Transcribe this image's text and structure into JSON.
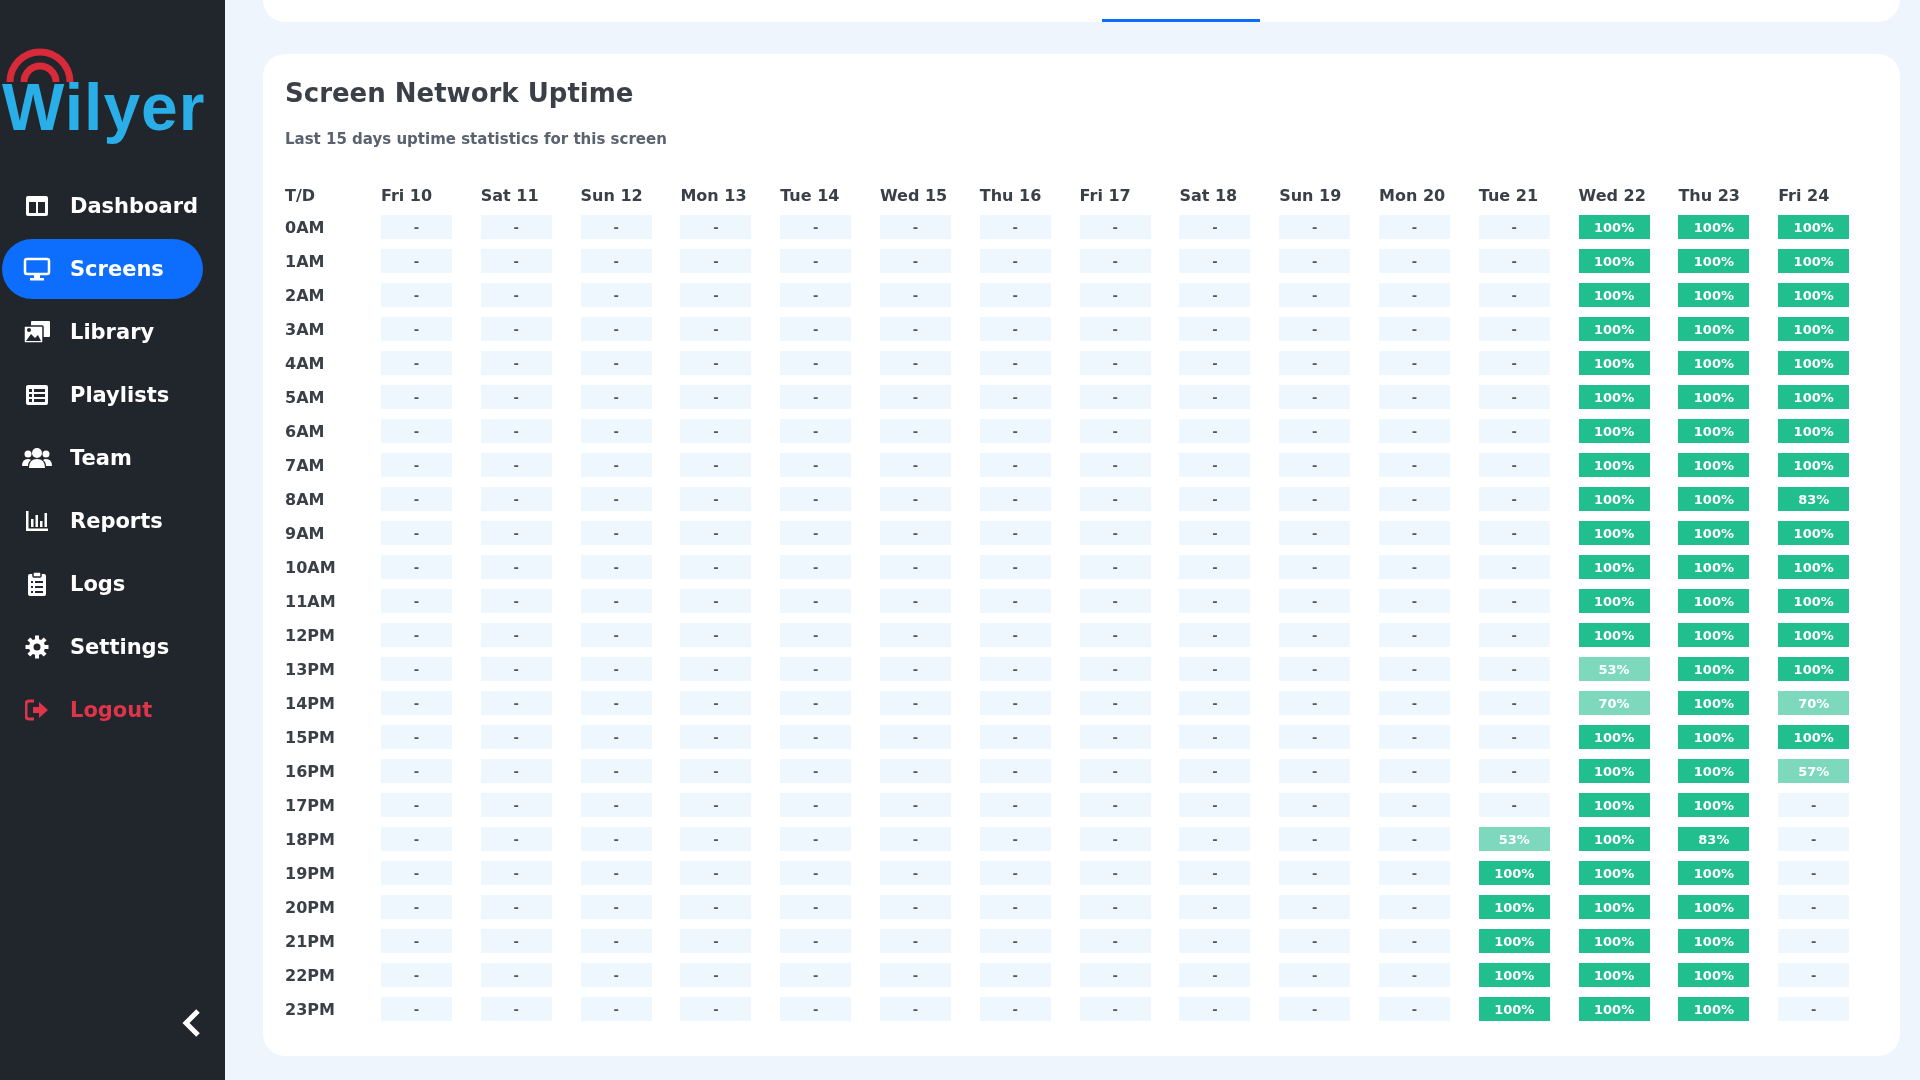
{
  "sidebar": {
    "logo": "Wilyer",
    "items": [
      {
        "label": "Dashboard",
        "selected": false,
        "kind": "normal"
      },
      {
        "label": "Screens",
        "selected": true,
        "kind": "normal"
      },
      {
        "label": "Library",
        "selected": false,
        "kind": "normal"
      },
      {
        "label": "Playlists",
        "selected": false,
        "kind": "normal"
      },
      {
        "label": "Team",
        "selected": false,
        "kind": "normal"
      },
      {
        "label": "Reports",
        "selected": false,
        "kind": "normal"
      },
      {
        "label": "Logs",
        "selected": false,
        "kind": "normal"
      },
      {
        "label": "Settings",
        "selected": false,
        "kind": "normal"
      },
      {
        "label": "Logout",
        "selected": false,
        "kind": "danger"
      }
    ]
  },
  "uptime": {
    "title": "Screen Network Uptime",
    "subtitle": "Last 15 days uptime statistics for this screen",
    "corner": "T/D",
    "columns": [
      "Fri 10",
      "Sat 11",
      "Sun 12",
      "Mon 13",
      "Tue 14",
      "Wed 15",
      "Thu 16",
      "Fri 17",
      "Sat 18",
      "Sun 19",
      "Mon 20",
      "Tue 21",
      "Wed 22",
      "Thu 23",
      "Fri 24"
    ],
    "rows": [
      {
        "time": "0AM",
        "cells": [
          {
            "text": "-",
            "kind": "empty"
          },
          {
            "text": "-",
            "kind": "empty"
          },
          {
            "text": "-",
            "kind": "empty"
          },
          {
            "text": "-",
            "kind": "empty"
          },
          {
            "text": "-",
            "kind": "empty"
          },
          {
            "text": "-",
            "kind": "empty"
          },
          {
            "text": "-",
            "kind": "empty"
          },
          {
            "text": "-",
            "kind": "empty"
          },
          {
            "text": "-",
            "kind": "empty"
          },
          {
            "text": "-",
            "kind": "empty"
          },
          {
            "text": "-",
            "kind": "empty"
          },
          {
            "text": "-",
            "kind": "empty"
          },
          {
            "text": "100%",
            "kind": "full"
          },
          {
            "text": "100%",
            "kind": "full"
          },
          {
            "text": "100%",
            "kind": "full"
          }
        ]
      },
      {
        "time": "1AM",
        "cells": [
          {
            "text": "-",
            "kind": "empty"
          },
          {
            "text": "-",
            "kind": "empty"
          },
          {
            "text": "-",
            "kind": "empty"
          },
          {
            "text": "-",
            "kind": "empty"
          },
          {
            "text": "-",
            "kind": "empty"
          },
          {
            "text": "-",
            "kind": "empty"
          },
          {
            "text": "-",
            "kind": "empty"
          },
          {
            "text": "-",
            "kind": "empty"
          },
          {
            "text": "-",
            "kind": "empty"
          },
          {
            "text": "-",
            "kind": "empty"
          },
          {
            "text": "-",
            "kind": "empty"
          },
          {
            "text": "-",
            "kind": "empty"
          },
          {
            "text": "100%",
            "kind": "full"
          },
          {
            "text": "100%",
            "kind": "full"
          },
          {
            "text": "100%",
            "kind": "full"
          }
        ]
      },
      {
        "time": "2AM",
        "cells": [
          {
            "text": "-",
            "kind": "empty"
          },
          {
            "text": "-",
            "kind": "empty"
          },
          {
            "text": "-",
            "kind": "empty"
          },
          {
            "text": "-",
            "kind": "empty"
          },
          {
            "text": "-",
            "kind": "empty"
          },
          {
            "text": "-",
            "kind": "empty"
          },
          {
            "text": "-",
            "kind": "empty"
          },
          {
            "text": "-",
            "kind": "empty"
          },
          {
            "text": "-",
            "kind": "empty"
          },
          {
            "text": "-",
            "kind": "empty"
          },
          {
            "text": "-",
            "kind": "empty"
          },
          {
            "text": "-",
            "kind": "empty"
          },
          {
            "text": "100%",
            "kind": "full"
          },
          {
            "text": "100%",
            "kind": "full"
          },
          {
            "text": "100%",
            "kind": "full"
          }
        ]
      },
      {
        "time": "3AM",
        "cells": [
          {
            "text": "-",
            "kind": "empty"
          },
          {
            "text": "-",
            "kind": "empty"
          },
          {
            "text": "-",
            "kind": "empty"
          },
          {
            "text": "-",
            "kind": "empty"
          },
          {
            "text": "-",
            "kind": "empty"
          },
          {
            "text": "-",
            "kind": "empty"
          },
          {
            "text": "-",
            "kind": "empty"
          },
          {
            "text": "-",
            "kind": "empty"
          },
          {
            "text": "-",
            "kind": "empty"
          },
          {
            "text": "-",
            "kind": "empty"
          },
          {
            "text": "-",
            "kind": "empty"
          },
          {
            "text": "-",
            "kind": "empty"
          },
          {
            "text": "100%",
            "kind": "full"
          },
          {
            "text": "100%",
            "kind": "full"
          },
          {
            "text": "100%",
            "kind": "full"
          }
        ]
      },
      {
        "time": "4AM",
        "cells": [
          {
            "text": "-",
            "kind": "empty"
          },
          {
            "text": "-",
            "kind": "empty"
          },
          {
            "text": "-",
            "kind": "empty"
          },
          {
            "text": "-",
            "kind": "empty"
          },
          {
            "text": "-",
            "kind": "empty"
          },
          {
            "text": "-",
            "kind": "empty"
          },
          {
            "text": "-",
            "kind": "empty"
          },
          {
            "text": "-",
            "kind": "empty"
          },
          {
            "text": "-",
            "kind": "empty"
          },
          {
            "text": "-",
            "kind": "empty"
          },
          {
            "text": "-",
            "kind": "empty"
          },
          {
            "text": "-",
            "kind": "empty"
          },
          {
            "text": "100%",
            "kind": "full"
          },
          {
            "text": "100%",
            "kind": "full"
          },
          {
            "text": "100%",
            "kind": "full"
          }
        ]
      },
      {
        "time": "5AM",
        "cells": [
          {
            "text": "-",
            "kind": "empty"
          },
          {
            "text": "-",
            "kind": "empty"
          },
          {
            "text": "-",
            "kind": "empty"
          },
          {
            "text": "-",
            "kind": "empty"
          },
          {
            "text": "-",
            "kind": "empty"
          },
          {
            "text": "-",
            "kind": "empty"
          },
          {
            "text": "-",
            "kind": "empty"
          },
          {
            "text": "-",
            "kind": "empty"
          },
          {
            "text": "-",
            "kind": "empty"
          },
          {
            "text": "-",
            "kind": "empty"
          },
          {
            "text": "-",
            "kind": "empty"
          },
          {
            "text": "-",
            "kind": "empty"
          },
          {
            "text": "100%",
            "kind": "full"
          },
          {
            "text": "100%",
            "kind": "full"
          },
          {
            "text": "100%",
            "kind": "full"
          }
        ]
      },
      {
        "time": "6AM",
        "cells": [
          {
            "text": "-",
            "kind": "empty"
          },
          {
            "text": "-",
            "kind": "empty"
          },
          {
            "text": "-",
            "kind": "empty"
          },
          {
            "text": "-",
            "kind": "empty"
          },
          {
            "text": "-",
            "kind": "empty"
          },
          {
            "text": "-",
            "kind": "empty"
          },
          {
            "text": "-",
            "kind": "empty"
          },
          {
            "text": "-",
            "kind": "empty"
          },
          {
            "text": "-",
            "kind": "empty"
          },
          {
            "text": "-",
            "kind": "empty"
          },
          {
            "text": "-",
            "kind": "empty"
          },
          {
            "text": "-",
            "kind": "empty"
          },
          {
            "text": "100%",
            "kind": "full"
          },
          {
            "text": "100%",
            "kind": "full"
          },
          {
            "text": "100%",
            "kind": "full"
          }
        ]
      },
      {
        "time": "7AM",
        "cells": [
          {
            "text": "-",
            "kind": "empty"
          },
          {
            "text": "-",
            "kind": "empty"
          },
          {
            "text": "-",
            "kind": "empty"
          },
          {
            "text": "-",
            "kind": "empty"
          },
          {
            "text": "-",
            "kind": "empty"
          },
          {
            "text": "-",
            "kind": "empty"
          },
          {
            "text": "-",
            "kind": "empty"
          },
          {
            "text": "-",
            "kind": "empty"
          },
          {
            "text": "-",
            "kind": "empty"
          },
          {
            "text": "-",
            "kind": "empty"
          },
          {
            "text": "-",
            "kind": "empty"
          },
          {
            "text": "-",
            "kind": "empty"
          },
          {
            "text": "100%",
            "kind": "full"
          },
          {
            "text": "100%",
            "kind": "full"
          },
          {
            "text": "100%",
            "kind": "full"
          }
        ]
      },
      {
        "time": "8AM",
        "cells": [
          {
            "text": "-",
            "kind": "empty"
          },
          {
            "text": "-",
            "kind": "empty"
          },
          {
            "text": "-",
            "kind": "empty"
          },
          {
            "text": "-",
            "kind": "empty"
          },
          {
            "text": "-",
            "kind": "empty"
          },
          {
            "text": "-",
            "kind": "empty"
          },
          {
            "text": "-",
            "kind": "empty"
          },
          {
            "text": "-",
            "kind": "empty"
          },
          {
            "text": "-",
            "kind": "empty"
          },
          {
            "text": "-",
            "kind": "empty"
          },
          {
            "text": "-",
            "kind": "empty"
          },
          {
            "text": "-",
            "kind": "empty"
          },
          {
            "text": "100%",
            "kind": "full"
          },
          {
            "text": "100%",
            "kind": "full"
          },
          {
            "text": "83%",
            "kind": "full"
          }
        ]
      },
      {
        "time": "9AM",
        "cells": [
          {
            "text": "-",
            "kind": "empty"
          },
          {
            "text": "-",
            "kind": "empty"
          },
          {
            "text": "-",
            "kind": "empty"
          },
          {
            "text": "-",
            "kind": "empty"
          },
          {
            "text": "-",
            "kind": "empty"
          },
          {
            "text": "-",
            "kind": "empty"
          },
          {
            "text": "-",
            "kind": "empty"
          },
          {
            "text": "-",
            "kind": "empty"
          },
          {
            "text": "-",
            "kind": "empty"
          },
          {
            "text": "-",
            "kind": "empty"
          },
          {
            "text": "-",
            "kind": "empty"
          },
          {
            "text": "-",
            "kind": "empty"
          },
          {
            "text": "100%",
            "kind": "full"
          },
          {
            "text": "100%",
            "kind": "full"
          },
          {
            "text": "100%",
            "kind": "full"
          }
        ]
      },
      {
        "time": "10AM",
        "cells": [
          {
            "text": "-",
            "kind": "empty"
          },
          {
            "text": "-",
            "kind": "empty"
          },
          {
            "text": "-",
            "kind": "empty"
          },
          {
            "text": "-",
            "kind": "empty"
          },
          {
            "text": "-",
            "kind": "empty"
          },
          {
            "text": "-",
            "kind": "empty"
          },
          {
            "text": "-",
            "kind": "empty"
          },
          {
            "text": "-",
            "kind": "empty"
          },
          {
            "text": "-",
            "kind": "empty"
          },
          {
            "text": "-",
            "kind": "empty"
          },
          {
            "text": "-",
            "kind": "empty"
          },
          {
            "text": "-",
            "kind": "empty"
          },
          {
            "text": "100%",
            "kind": "full"
          },
          {
            "text": "100%",
            "kind": "full"
          },
          {
            "text": "100%",
            "kind": "full"
          }
        ]
      },
      {
        "time": "11AM",
        "cells": [
          {
            "text": "-",
            "kind": "empty"
          },
          {
            "text": "-",
            "kind": "empty"
          },
          {
            "text": "-",
            "kind": "empty"
          },
          {
            "text": "-",
            "kind": "empty"
          },
          {
            "text": "-",
            "kind": "empty"
          },
          {
            "text": "-",
            "kind": "empty"
          },
          {
            "text": "-",
            "kind": "empty"
          },
          {
            "text": "-",
            "kind": "empty"
          },
          {
            "text": "-",
            "kind": "empty"
          },
          {
            "text": "-",
            "kind": "empty"
          },
          {
            "text": "-",
            "kind": "empty"
          },
          {
            "text": "-",
            "kind": "empty"
          },
          {
            "text": "100%",
            "kind": "full"
          },
          {
            "text": "100%",
            "kind": "full"
          },
          {
            "text": "100%",
            "kind": "full"
          }
        ]
      },
      {
        "time": "12PM",
        "cells": [
          {
            "text": "-",
            "kind": "empty"
          },
          {
            "text": "-",
            "kind": "empty"
          },
          {
            "text": "-",
            "kind": "empty"
          },
          {
            "text": "-",
            "kind": "empty"
          },
          {
            "text": "-",
            "kind": "empty"
          },
          {
            "text": "-",
            "kind": "empty"
          },
          {
            "text": "-",
            "kind": "empty"
          },
          {
            "text": "-",
            "kind": "empty"
          },
          {
            "text": "-",
            "kind": "empty"
          },
          {
            "text": "-",
            "kind": "empty"
          },
          {
            "text": "-",
            "kind": "empty"
          },
          {
            "text": "-",
            "kind": "empty"
          },
          {
            "text": "100%",
            "kind": "full"
          },
          {
            "text": "100%",
            "kind": "full"
          },
          {
            "text": "100%",
            "kind": "full"
          }
        ]
      },
      {
        "time": "13PM",
        "cells": [
          {
            "text": "-",
            "kind": "empty"
          },
          {
            "text": "-",
            "kind": "empty"
          },
          {
            "text": "-",
            "kind": "empty"
          },
          {
            "text": "-",
            "kind": "empty"
          },
          {
            "text": "-",
            "kind": "empty"
          },
          {
            "text": "-",
            "kind": "empty"
          },
          {
            "text": "-",
            "kind": "empty"
          },
          {
            "text": "-",
            "kind": "empty"
          },
          {
            "text": "-",
            "kind": "empty"
          },
          {
            "text": "-",
            "kind": "empty"
          },
          {
            "text": "-",
            "kind": "empty"
          },
          {
            "text": "-",
            "kind": "empty"
          },
          {
            "text": "53%",
            "kind": "partial"
          },
          {
            "text": "100%",
            "kind": "full"
          },
          {
            "text": "100%",
            "kind": "full"
          }
        ]
      },
      {
        "time": "14PM",
        "cells": [
          {
            "text": "-",
            "kind": "empty"
          },
          {
            "text": "-",
            "kind": "empty"
          },
          {
            "text": "-",
            "kind": "empty"
          },
          {
            "text": "-",
            "kind": "empty"
          },
          {
            "text": "-",
            "kind": "empty"
          },
          {
            "text": "-",
            "kind": "empty"
          },
          {
            "text": "-",
            "kind": "empty"
          },
          {
            "text": "-",
            "kind": "empty"
          },
          {
            "text": "-",
            "kind": "empty"
          },
          {
            "text": "-",
            "kind": "empty"
          },
          {
            "text": "-",
            "kind": "empty"
          },
          {
            "text": "-",
            "kind": "empty"
          },
          {
            "text": "70%",
            "kind": "partial"
          },
          {
            "text": "100%",
            "kind": "full"
          },
          {
            "text": "70%",
            "kind": "partial"
          }
        ]
      },
      {
        "time": "15PM",
        "cells": [
          {
            "text": "-",
            "kind": "empty"
          },
          {
            "text": "-",
            "kind": "empty"
          },
          {
            "text": "-",
            "kind": "empty"
          },
          {
            "text": "-",
            "kind": "empty"
          },
          {
            "text": "-",
            "kind": "empty"
          },
          {
            "text": "-",
            "kind": "empty"
          },
          {
            "text": "-",
            "kind": "empty"
          },
          {
            "text": "-",
            "kind": "empty"
          },
          {
            "text": "-",
            "kind": "empty"
          },
          {
            "text": "-",
            "kind": "empty"
          },
          {
            "text": "-",
            "kind": "empty"
          },
          {
            "text": "-",
            "kind": "empty"
          },
          {
            "text": "100%",
            "kind": "full"
          },
          {
            "text": "100%",
            "kind": "full"
          },
          {
            "text": "100%",
            "kind": "full"
          }
        ]
      },
      {
        "time": "16PM",
        "cells": [
          {
            "text": "-",
            "kind": "empty"
          },
          {
            "text": "-",
            "kind": "empty"
          },
          {
            "text": "-",
            "kind": "empty"
          },
          {
            "text": "-",
            "kind": "empty"
          },
          {
            "text": "-",
            "kind": "empty"
          },
          {
            "text": "-",
            "kind": "empty"
          },
          {
            "text": "-",
            "kind": "empty"
          },
          {
            "text": "-",
            "kind": "empty"
          },
          {
            "text": "-",
            "kind": "empty"
          },
          {
            "text": "-",
            "kind": "empty"
          },
          {
            "text": "-",
            "kind": "empty"
          },
          {
            "text": "-",
            "kind": "empty"
          },
          {
            "text": "100%",
            "kind": "full"
          },
          {
            "text": "100%",
            "kind": "full"
          },
          {
            "text": "57%",
            "kind": "partial"
          }
        ]
      },
      {
        "time": "17PM",
        "cells": [
          {
            "text": "-",
            "kind": "empty"
          },
          {
            "text": "-",
            "kind": "empty"
          },
          {
            "text": "-",
            "kind": "empty"
          },
          {
            "text": "-",
            "kind": "empty"
          },
          {
            "text": "-",
            "kind": "empty"
          },
          {
            "text": "-",
            "kind": "empty"
          },
          {
            "text": "-",
            "kind": "empty"
          },
          {
            "text": "-",
            "kind": "empty"
          },
          {
            "text": "-",
            "kind": "empty"
          },
          {
            "text": "-",
            "kind": "empty"
          },
          {
            "text": "-",
            "kind": "empty"
          },
          {
            "text": "-",
            "kind": "empty"
          },
          {
            "text": "100%",
            "kind": "full"
          },
          {
            "text": "100%",
            "kind": "full"
          },
          {
            "text": "-",
            "kind": "empty"
          }
        ]
      },
      {
        "time": "18PM",
        "cells": [
          {
            "text": "-",
            "kind": "empty"
          },
          {
            "text": "-",
            "kind": "empty"
          },
          {
            "text": "-",
            "kind": "empty"
          },
          {
            "text": "-",
            "kind": "empty"
          },
          {
            "text": "-",
            "kind": "empty"
          },
          {
            "text": "-",
            "kind": "empty"
          },
          {
            "text": "-",
            "kind": "empty"
          },
          {
            "text": "-",
            "kind": "empty"
          },
          {
            "text": "-",
            "kind": "empty"
          },
          {
            "text": "-",
            "kind": "empty"
          },
          {
            "text": "-",
            "kind": "empty"
          },
          {
            "text": "53%",
            "kind": "partial"
          },
          {
            "text": "100%",
            "kind": "full"
          },
          {
            "text": "83%",
            "kind": "full"
          },
          {
            "text": "-",
            "kind": "empty"
          }
        ]
      },
      {
        "time": "19PM",
        "cells": [
          {
            "text": "-",
            "kind": "empty"
          },
          {
            "text": "-",
            "kind": "empty"
          },
          {
            "text": "-",
            "kind": "empty"
          },
          {
            "text": "-",
            "kind": "empty"
          },
          {
            "text": "-",
            "kind": "empty"
          },
          {
            "text": "-",
            "kind": "empty"
          },
          {
            "text": "-",
            "kind": "empty"
          },
          {
            "text": "-",
            "kind": "empty"
          },
          {
            "text": "-",
            "kind": "empty"
          },
          {
            "text": "-",
            "kind": "empty"
          },
          {
            "text": "-",
            "kind": "empty"
          },
          {
            "text": "100%",
            "kind": "full"
          },
          {
            "text": "100%",
            "kind": "full"
          },
          {
            "text": "100%",
            "kind": "full"
          },
          {
            "text": "-",
            "kind": "empty"
          }
        ]
      },
      {
        "time": "20PM",
        "cells": [
          {
            "text": "-",
            "kind": "empty"
          },
          {
            "text": "-",
            "kind": "empty"
          },
          {
            "text": "-",
            "kind": "empty"
          },
          {
            "text": "-",
            "kind": "empty"
          },
          {
            "text": "-",
            "kind": "empty"
          },
          {
            "text": "-",
            "kind": "empty"
          },
          {
            "text": "-",
            "kind": "empty"
          },
          {
            "text": "-",
            "kind": "empty"
          },
          {
            "text": "-",
            "kind": "empty"
          },
          {
            "text": "-",
            "kind": "empty"
          },
          {
            "text": "-",
            "kind": "empty"
          },
          {
            "text": "100%",
            "kind": "full"
          },
          {
            "text": "100%",
            "kind": "full"
          },
          {
            "text": "100%",
            "kind": "full"
          },
          {
            "text": "-",
            "kind": "empty"
          }
        ]
      },
      {
        "time": "21PM",
        "cells": [
          {
            "text": "-",
            "kind": "empty"
          },
          {
            "text": "-",
            "kind": "empty"
          },
          {
            "text": "-",
            "kind": "empty"
          },
          {
            "text": "-",
            "kind": "empty"
          },
          {
            "text": "-",
            "kind": "empty"
          },
          {
            "text": "-",
            "kind": "empty"
          },
          {
            "text": "-",
            "kind": "empty"
          },
          {
            "text": "-",
            "kind": "empty"
          },
          {
            "text": "-",
            "kind": "empty"
          },
          {
            "text": "-",
            "kind": "empty"
          },
          {
            "text": "-",
            "kind": "empty"
          },
          {
            "text": "100%",
            "kind": "full"
          },
          {
            "text": "100%",
            "kind": "full"
          },
          {
            "text": "100%",
            "kind": "full"
          },
          {
            "text": "-",
            "kind": "empty"
          }
        ]
      },
      {
        "time": "22PM",
        "cells": [
          {
            "text": "-",
            "kind": "empty"
          },
          {
            "text": "-",
            "kind": "empty"
          },
          {
            "text": "-",
            "kind": "empty"
          },
          {
            "text": "-",
            "kind": "empty"
          },
          {
            "text": "-",
            "kind": "empty"
          },
          {
            "text": "-",
            "kind": "empty"
          },
          {
            "text": "-",
            "kind": "empty"
          },
          {
            "text": "-",
            "kind": "empty"
          },
          {
            "text": "-",
            "kind": "empty"
          },
          {
            "text": "-",
            "kind": "empty"
          },
          {
            "text": "-",
            "kind": "empty"
          },
          {
            "text": "100%",
            "kind": "full"
          },
          {
            "text": "100%",
            "kind": "full"
          },
          {
            "text": "100%",
            "kind": "full"
          },
          {
            "text": "-",
            "kind": "empty"
          }
        ]
      },
      {
        "time": "23PM",
        "cells": [
          {
            "text": "-",
            "kind": "empty"
          },
          {
            "text": "-",
            "kind": "empty"
          },
          {
            "text": "-",
            "kind": "empty"
          },
          {
            "text": "-",
            "kind": "empty"
          },
          {
            "text": "-",
            "kind": "empty"
          },
          {
            "text": "-",
            "kind": "empty"
          },
          {
            "text": "-",
            "kind": "empty"
          },
          {
            "text": "-",
            "kind": "empty"
          },
          {
            "text": "-",
            "kind": "empty"
          },
          {
            "text": "-",
            "kind": "empty"
          },
          {
            "text": "-",
            "kind": "empty"
          },
          {
            "text": "100%",
            "kind": "full"
          },
          {
            "text": "100%",
            "kind": "full"
          },
          {
            "text": "100%",
            "kind": "full"
          },
          {
            "text": "-",
            "kind": "empty"
          }
        ]
      }
    ]
  }
}
